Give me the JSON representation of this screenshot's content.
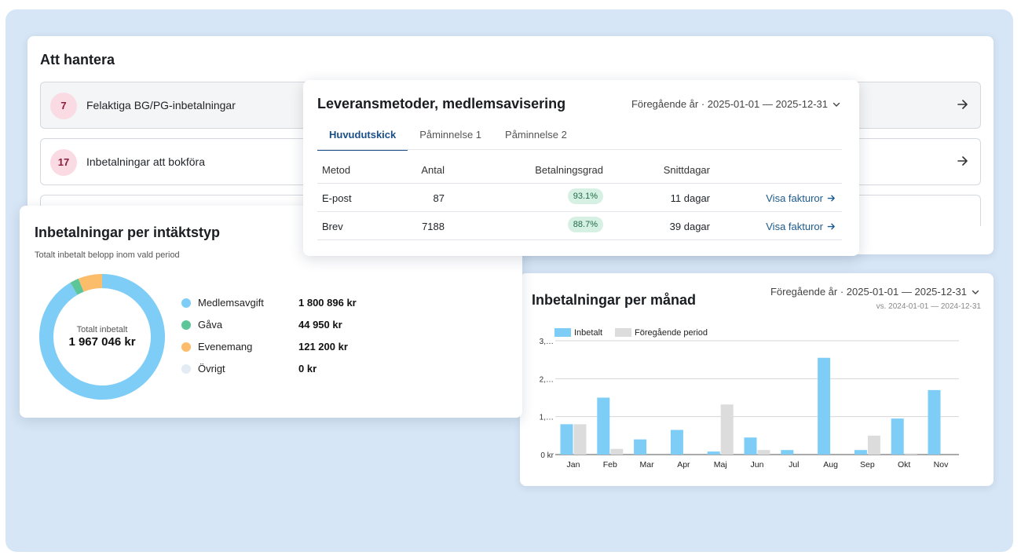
{
  "todo": {
    "title": "Att hantera",
    "items": [
      {
        "count": "7",
        "label": "Felaktiga BG/PG-inbetalningar"
      },
      {
        "count": "17",
        "label": "Inbetalningar att bokföra"
      }
    ]
  },
  "leverans": {
    "title": "Leveransmetoder, medlemsavisering",
    "period": "Föregående år · 2025-01-01 — 2025-12-31",
    "tabs": [
      {
        "label": "Huvudutskick"
      },
      {
        "label": "Påminnelse 1"
      },
      {
        "label": "Påminnelse 2"
      }
    ],
    "columns": {
      "metod": "Metod",
      "antal": "Antal",
      "grad": "Betalningsgrad",
      "snitt": "Snittdagar"
    },
    "rows": [
      {
        "metod": "E-post",
        "antal": "87",
        "grad": "93.1%",
        "snitt": "11 dagar",
        "link": "Visa fakturor"
      },
      {
        "metod": "Brev",
        "antal": "7188",
        "grad": "88.7%",
        "snitt": "39 dagar",
        "link": "Visa fakturor"
      }
    ]
  },
  "intakt": {
    "title": "Inbetalningar per intäktstyp",
    "subtitle": "Totalt inbetalt belopp inom vald period",
    "total_label": "Totalt inbetalt",
    "total_value": "1 967 046 kr",
    "legend": [
      {
        "name": "Medlemsavgift",
        "value": "1 800 896 kr",
        "amount": 1800896,
        "color": "#7dcdf7"
      },
      {
        "name": "Gåva",
        "value": "44 950 kr",
        "amount": 44950,
        "color": "#5cc699"
      },
      {
        "name": "Evenemang",
        "value": "121 200 kr",
        "amount": 121200,
        "color": "#fbbd69"
      },
      {
        "name": "Övrigt",
        "value": "0 kr",
        "amount": 0,
        "color": "#e3ecf5"
      }
    ]
  },
  "manad": {
    "title": "Inbetalningar per månad",
    "period": "Föregående år · 2025-01-01 — 2025-12-31",
    "vs": "vs. 2024-01-01 — 2024-12-31"
  },
  "chart_data": {
    "type": "bar",
    "categories": [
      "Jan",
      "Feb",
      "Mar",
      "Apr",
      "Maj",
      "Jun",
      "Jul",
      "Aug",
      "Sep",
      "Okt",
      "Nov"
    ],
    "series": [
      {
        "name": "Inbetalt",
        "color": "#7dcdf7",
        "values": [
          0.8,
          1.5,
          0.4,
          0.65,
          0.08,
          0.45,
          0.12,
          2.55,
          0.12,
          0.95,
          1.7
        ]
      },
      {
        "name": "Föregående period",
        "color": "#dcdcdc",
        "values": [
          0.8,
          0.15,
          0.0,
          0.0,
          1.32,
          0.12,
          0.0,
          0.0,
          0.5,
          0.03,
          0.0
        ]
      }
    ],
    "ytick_labels": [
      "0 kr",
      "1,…",
      "2,…",
      "3,…"
    ],
    "ytick_values": [
      0,
      1,
      2,
      3
    ],
    "ylim": [
      0,
      3
    ],
    "grid": true,
    "legend": "top-left"
  },
  "icons": {
    "arrow": "arrow-right-icon",
    "chevron": "chevron-down-icon"
  }
}
